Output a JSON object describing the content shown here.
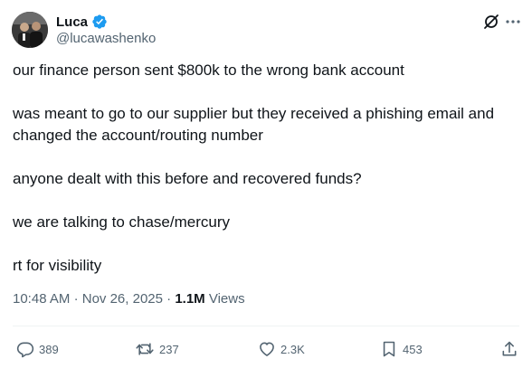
{
  "author": {
    "name": "Luca",
    "handle": "@lucawashenko",
    "verified_color": "#1d9bf0"
  },
  "icons": {
    "verified": "verified-badge-icon",
    "grok": "grok-icon",
    "more": "more-options-icon",
    "reply": "reply-icon",
    "retweet": "retweet-icon",
    "like": "heart-icon",
    "bookmark": "bookmark-icon",
    "share": "share-icon"
  },
  "post": {
    "paragraphs": [
      "our finance person sent $800k to the wrong bank account",
      "was meant to go to our supplier but they received a phishing email and changed the account/routing number",
      "anyone dealt with this before and recovered funds?",
      "we are talking to chase/mercury",
      "rt for visibility"
    ],
    "time": "10:48 AM",
    "date": "Nov 26, 2025",
    "views_count": "1.1M",
    "views_label": "Views"
  },
  "actions": {
    "replies": "389",
    "reposts": "237",
    "likes": "2.3K",
    "bookmarks": "453"
  },
  "colors": {
    "text": "#0f1419",
    "secondary": "#536471",
    "divider": "#eff3f4",
    "accent": "#1d9bf0"
  }
}
